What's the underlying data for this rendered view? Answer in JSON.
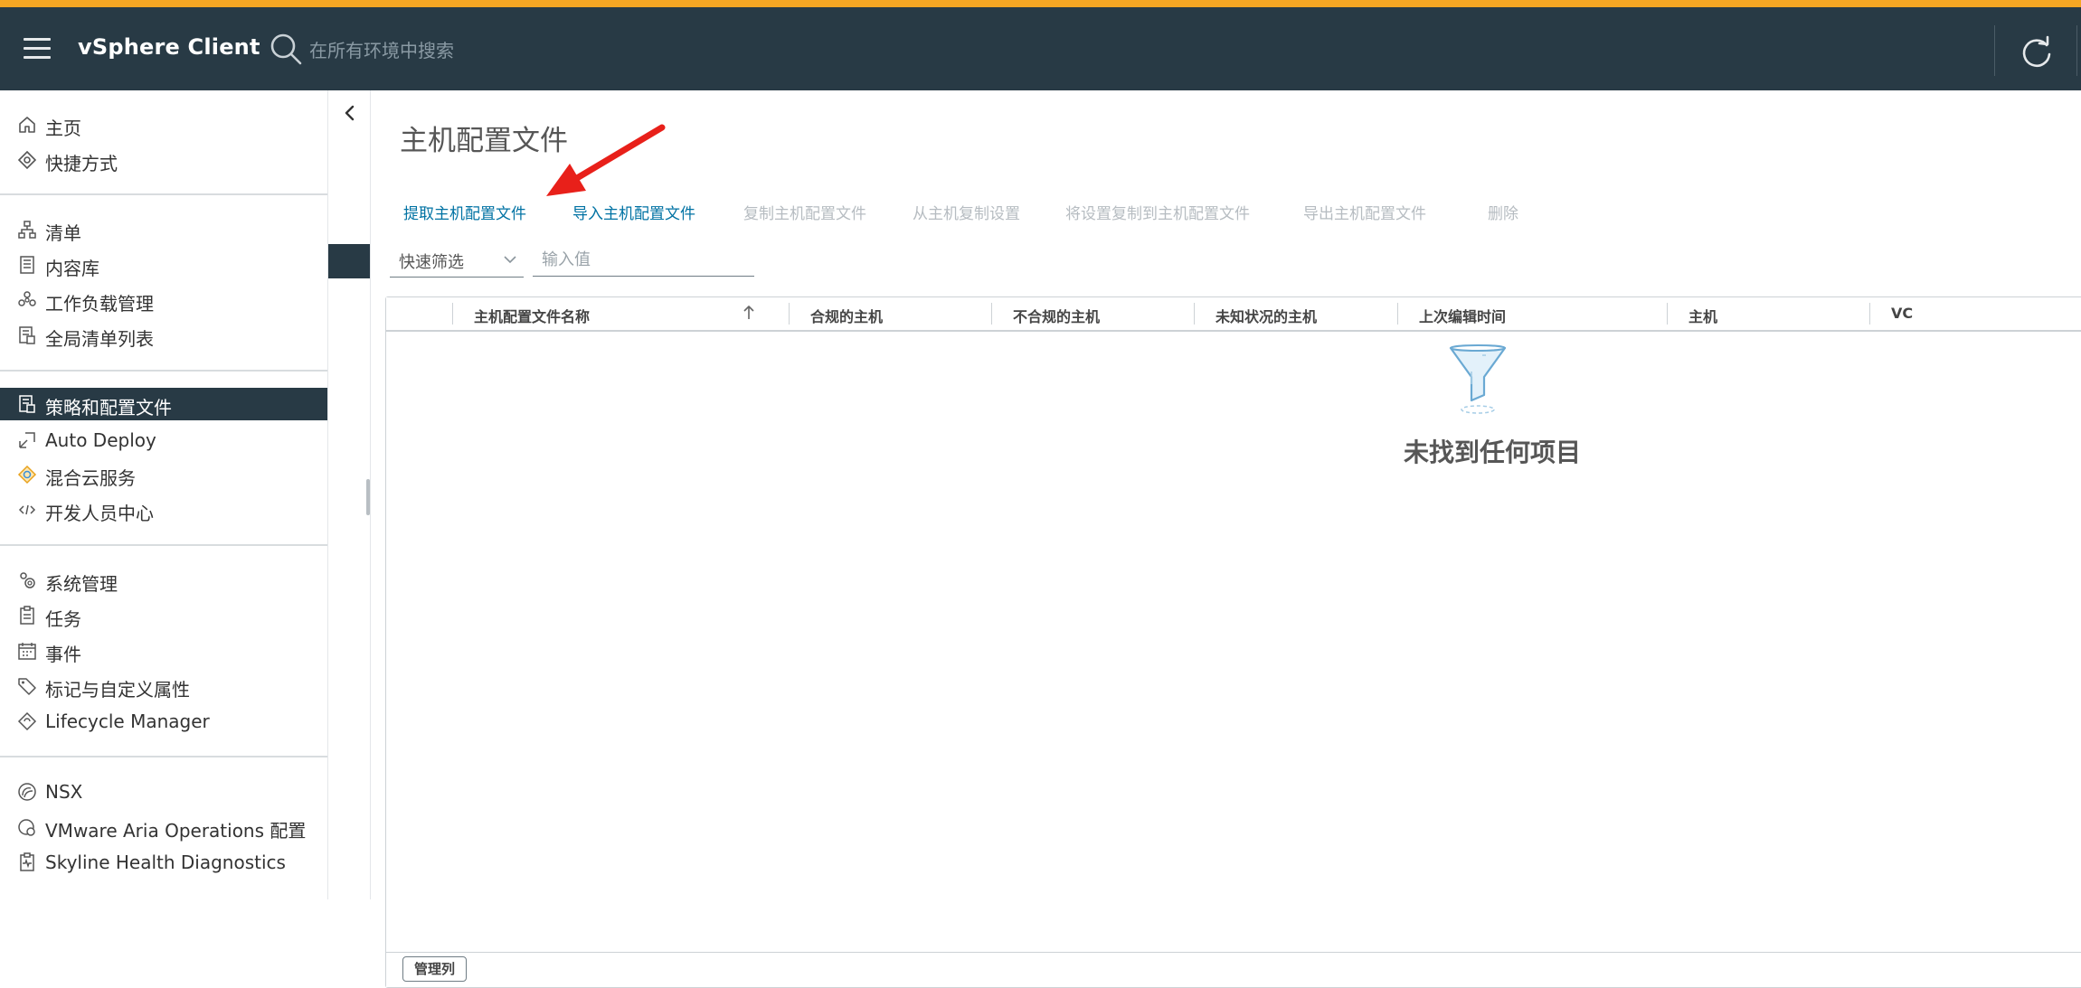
{
  "header": {
    "app_title": "vSphere Client",
    "search_placeholder": "在所有环境中搜索"
  },
  "sidebar": {
    "groups": [
      [
        {
          "label": "主页",
          "icon": "home-icon"
        },
        {
          "label": "快捷方式",
          "icon": "shortcuts-icon"
        }
      ],
      [
        {
          "label": "清单",
          "icon": "inventory-icon"
        },
        {
          "label": "内容库",
          "icon": "content-library-icon"
        },
        {
          "label": "工作负载管理",
          "icon": "workload-icon"
        },
        {
          "label": "全局清单列表",
          "icon": "global-inventory-icon"
        }
      ],
      [
        {
          "label": "策略和配置文件",
          "icon": "policies-icon",
          "active": true
        },
        {
          "label": "Auto Deploy",
          "icon": "auto-deploy-icon"
        },
        {
          "label": "混合云服务",
          "icon": "hybrid-cloud-icon"
        },
        {
          "label": "开发人员中心",
          "icon": "code-icon"
        }
      ],
      [
        {
          "label": "系统管理",
          "icon": "administration-icon"
        },
        {
          "label": "任务",
          "icon": "tasks-icon"
        },
        {
          "label": "事件",
          "icon": "events-icon"
        },
        {
          "label": "标记与自定义属性",
          "icon": "tag-icon"
        },
        {
          "label": "Lifecycle Manager",
          "icon": "lifecycle-icon"
        }
      ],
      [
        {
          "label": "NSX",
          "icon": "nsx-icon"
        },
        {
          "label": "VMware Aria Operations 配置",
          "icon": "aria-icon"
        },
        {
          "label": "Skyline Health Diagnostics",
          "icon": "skyline-icon"
        }
      ]
    ]
  },
  "main": {
    "title": "主机配置文件",
    "actions": [
      {
        "label": "提取主机配置文件",
        "enabled": true
      },
      {
        "label": "导入主机配置文件",
        "enabled": true
      },
      {
        "label": "复制主机配置文件",
        "enabled": false
      },
      {
        "label": "从主机复制设置",
        "enabled": false
      },
      {
        "label": "将设置复制到主机配置文件",
        "enabled": false
      },
      {
        "label": "导出主机配置文件",
        "enabled": false
      },
      {
        "label": "删除",
        "enabled": false
      }
    ],
    "filter": {
      "select_value": "快速筛选",
      "input_placeholder": "输入值"
    },
    "table": {
      "columns": [
        "主机配置文件名称",
        "合规的主机",
        "不合规的主机",
        "未知状况的主机",
        "上次编辑时间",
        "主机",
        "VC"
      ],
      "sort_column": "主机配置文件名称",
      "sort_direction": "ascending",
      "empty_text": "未找到任何项目"
    },
    "manage_columns_label": "管理列"
  },
  "colors": {
    "header_bg": "#283a45",
    "top_stripe": "#f5a623",
    "link": "#0072a3",
    "disabled": "#b6bcc1",
    "annotation_arrow": "#e8201a"
  }
}
